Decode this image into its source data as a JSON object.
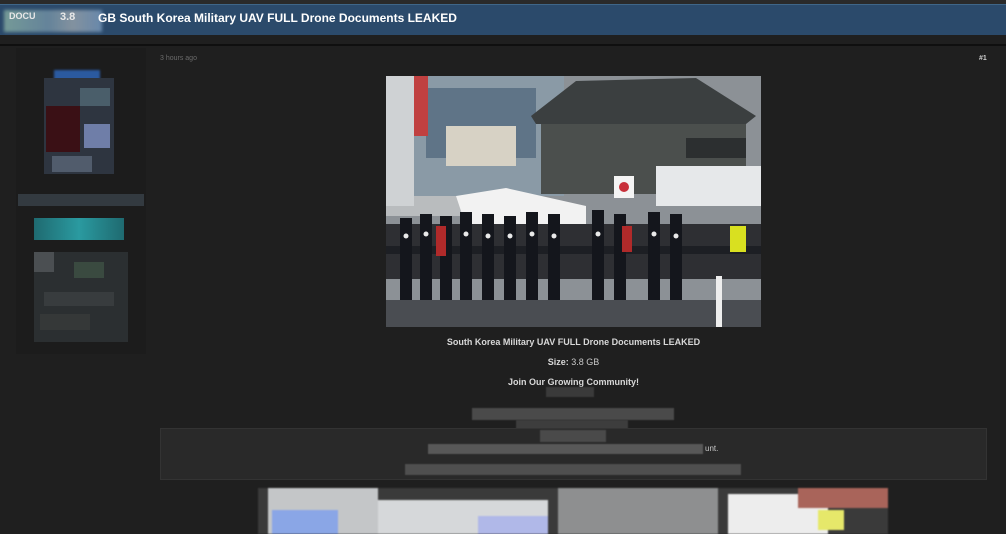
{
  "header": {
    "prefix_left": "DOCU",
    "prefix_mid": "3.8",
    "title": "GB South Korea Military UAV FULL Drone Documents LEAKED"
  },
  "post": {
    "time": "3 hours ago",
    "number": "#1",
    "image_alt": "South Korean honor guard marching in parade",
    "caption_title": "South Korea Military UAV FULL Drone Documents LEAKED",
    "size_label": "Size:",
    "size_value": "3.8 GB",
    "community": "Join Our Growing Community!",
    "box_tail": "unt."
  },
  "colors": {
    "bg": "#1f1f1f",
    "titlebar": "#2b4a6b",
    "text": "#d6d6d6"
  }
}
